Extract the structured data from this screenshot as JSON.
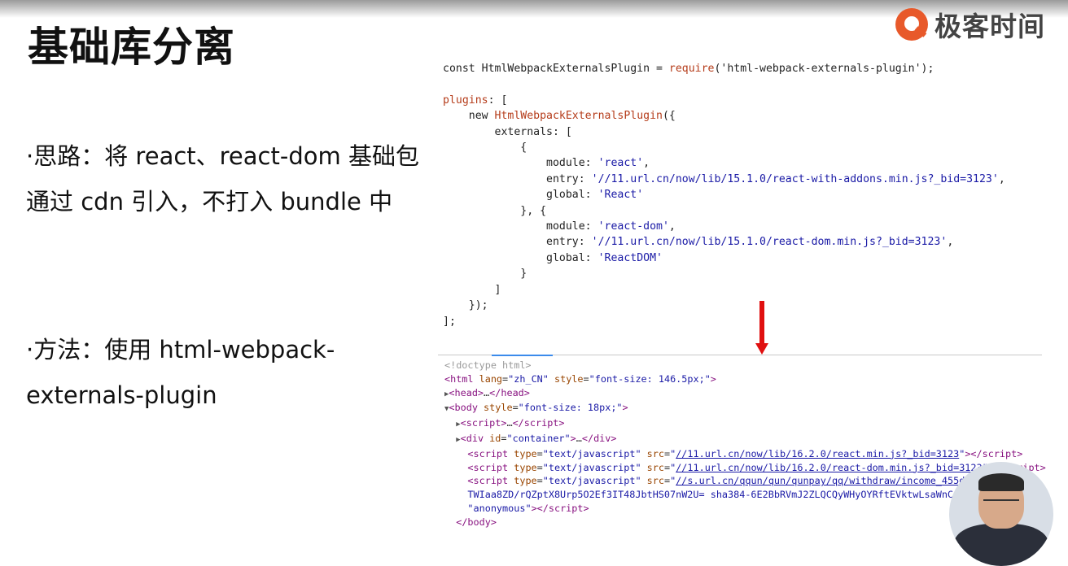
{
  "slide": {
    "title": "基础库分离",
    "brand": "极客时间",
    "bullets": [
      "·思路：将 react、react-dom 基础包通过 cdn 引入，不打入 bundle 中",
      "·方法：使用 html-webpack-externals-plugin"
    ]
  },
  "code": {
    "l1_const": "const HtmlWebpackExternalsPlugin = ",
    "l1_require": "require",
    "l1_arg": "('html-webpack-externals-plugin');",
    "l3_plugins": "plugins",
    "l3_rest": ": [",
    "l4_new": "    new ",
    "l4_cls": "HtmlWebpackExternalsPlugin",
    "l4_rest": "({",
    "l5": "        externals: [",
    "l6": "            {",
    "l7_key": "                module: ",
    "l7_val": "'react'",
    "l8_key": "                entry: ",
    "l8_val": "'//11.url.cn/now/lib/15.1.0/react-with-addons.min.js?_bid=3123'",
    "l9_key": "                global: ",
    "l9_val": "'React'",
    "l10": "            }, {",
    "l11_key": "                module: ",
    "l11_val": "'react-dom'",
    "l12_key": "                entry: ",
    "l12_val": "'//11.url.cn/now/lib/15.1.0/react-dom.min.js?_bid=3123'",
    "l13_key": "                global: ",
    "l13_val": "'ReactDOM'",
    "l14": "            }",
    "l15": "        ]",
    "l16": "    });",
    "l17": "];"
  },
  "devtools": {
    "doctype": "<!doctype html>",
    "html_lang": "zh_CN",
    "html_style": "font-size: 146.5px;",
    "body_style": "font-size: 18px;",
    "container_id": "container",
    "script_type": "text/javascript",
    "src1": "//11.url.cn/now/lib/16.2.0/react.min.js?_bid=3123",
    "src2": "//11.url.cn/now/lib/16.2.0/react-dom.min.js?_bid=3123",
    "src3": "//s.url.cn/qqun/qun/qunpay/qq/withdraw/income_455d05c8",
    "integrity_line": "TWIaa8ZD/rQZptX8Urp5O2Ef3IT48JbtHS07nW2U= sha384-6E2BbRVmJ2ZLQCQyWHyOYRftEVktwLsaWnC+8h1",
    "crossorigin": "\"anonymous\""
  }
}
